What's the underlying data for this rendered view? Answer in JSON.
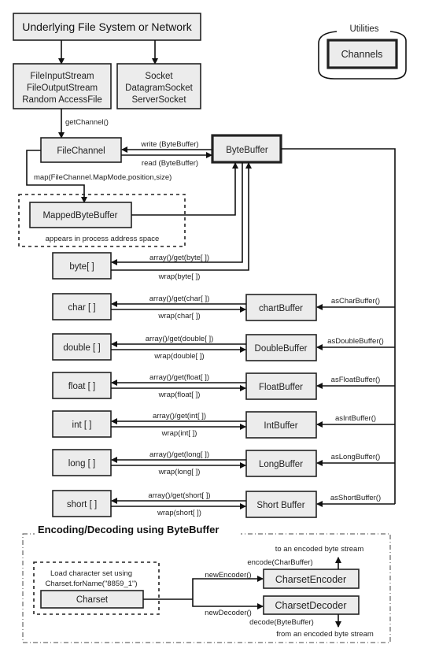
{
  "nodes": {
    "source": "Underlying File System or Network",
    "file_streams": [
      "FileInputStream",
      "FileOutputStream",
      "Random AccessFile"
    ],
    "sockets": [
      "Socket",
      "DatagramSocket",
      "ServerSocket"
    ],
    "utilities_label": "Utilities",
    "channels": "Channels",
    "file_channel": "FileChannel",
    "byte_buffer": "ByteBuffer",
    "mapped_byte_buffer": "MappedByteBuffer",
    "mapped_note": "appears in process address space"
  },
  "edges": {
    "get_channel": "getChannel()",
    "write": "write (ByteBuffer)",
    "read": "read (ByteBuffer)",
    "map": "map(FileChannel.MapMode,position,size)"
  },
  "byte_row": {
    "array": "byte[ ]",
    "get": "array()/get(byte[ ])",
    "wrap": "wrap(byte[ ])"
  },
  "rows": [
    {
      "array": "char [ ]",
      "buffer": "chartBuffer",
      "get": "array()/get(char[ ])",
      "wrap": "wrap(char[ ])",
      "as": "asCharBuffer()"
    },
    {
      "array": "double [ ]",
      "buffer": "DoubleBuffer",
      "get": "array()/get(double[ ])",
      "wrap": "wrap(double[ ])",
      "as": "asDoubleBuffer()"
    },
    {
      "array": "float [ ]",
      "buffer": "FloatBuffer",
      "get": "array()/get(float[ ])",
      "wrap": "wrap(float[ ])",
      "as": "asFloatBuffer()"
    },
    {
      "array": "int [ ]",
      "buffer": "IntBuffer",
      "get": "array()/get(int[ ])",
      "wrap": "wrap(int[ ])",
      "as": "asIntBuffer()"
    },
    {
      "array": "long [ ]",
      "buffer": "LongBuffer",
      "get": "array()/get(long[ ])",
      "wrap": "wrap(long[ ])",
      "as": "asLongBuffer()"
    },
    {
      "array": "short [ ]",
      "buffer": "Short Buffer",
      "get": "array()/get(short[ ])",
      "wrap": "wrap(short[ ])",
      "as": "asShortBuffer()"
    }
  ],
  "encoding": {
    "title": "Encoding/Decoding using ByteBuffer",
    "load_note_1": "Load character set using",
    "load_note_2": "Charset.forName(\"8859_1\")",
    "charset": "Charset",
    "new_encoder": "newEncoder()",
    "new_decoder": "newDecoder()",
    "encoder": "CharsetEncoder",
    "decoder": "CharsetDecoder",
    "encode": "encode(CharBuffer)",
    "decode": "decode(ByteBuffer)",
    "to_stream": "to an encoded byte stream",
    "from_stream": "from an encoded byte stream"
  }
}
